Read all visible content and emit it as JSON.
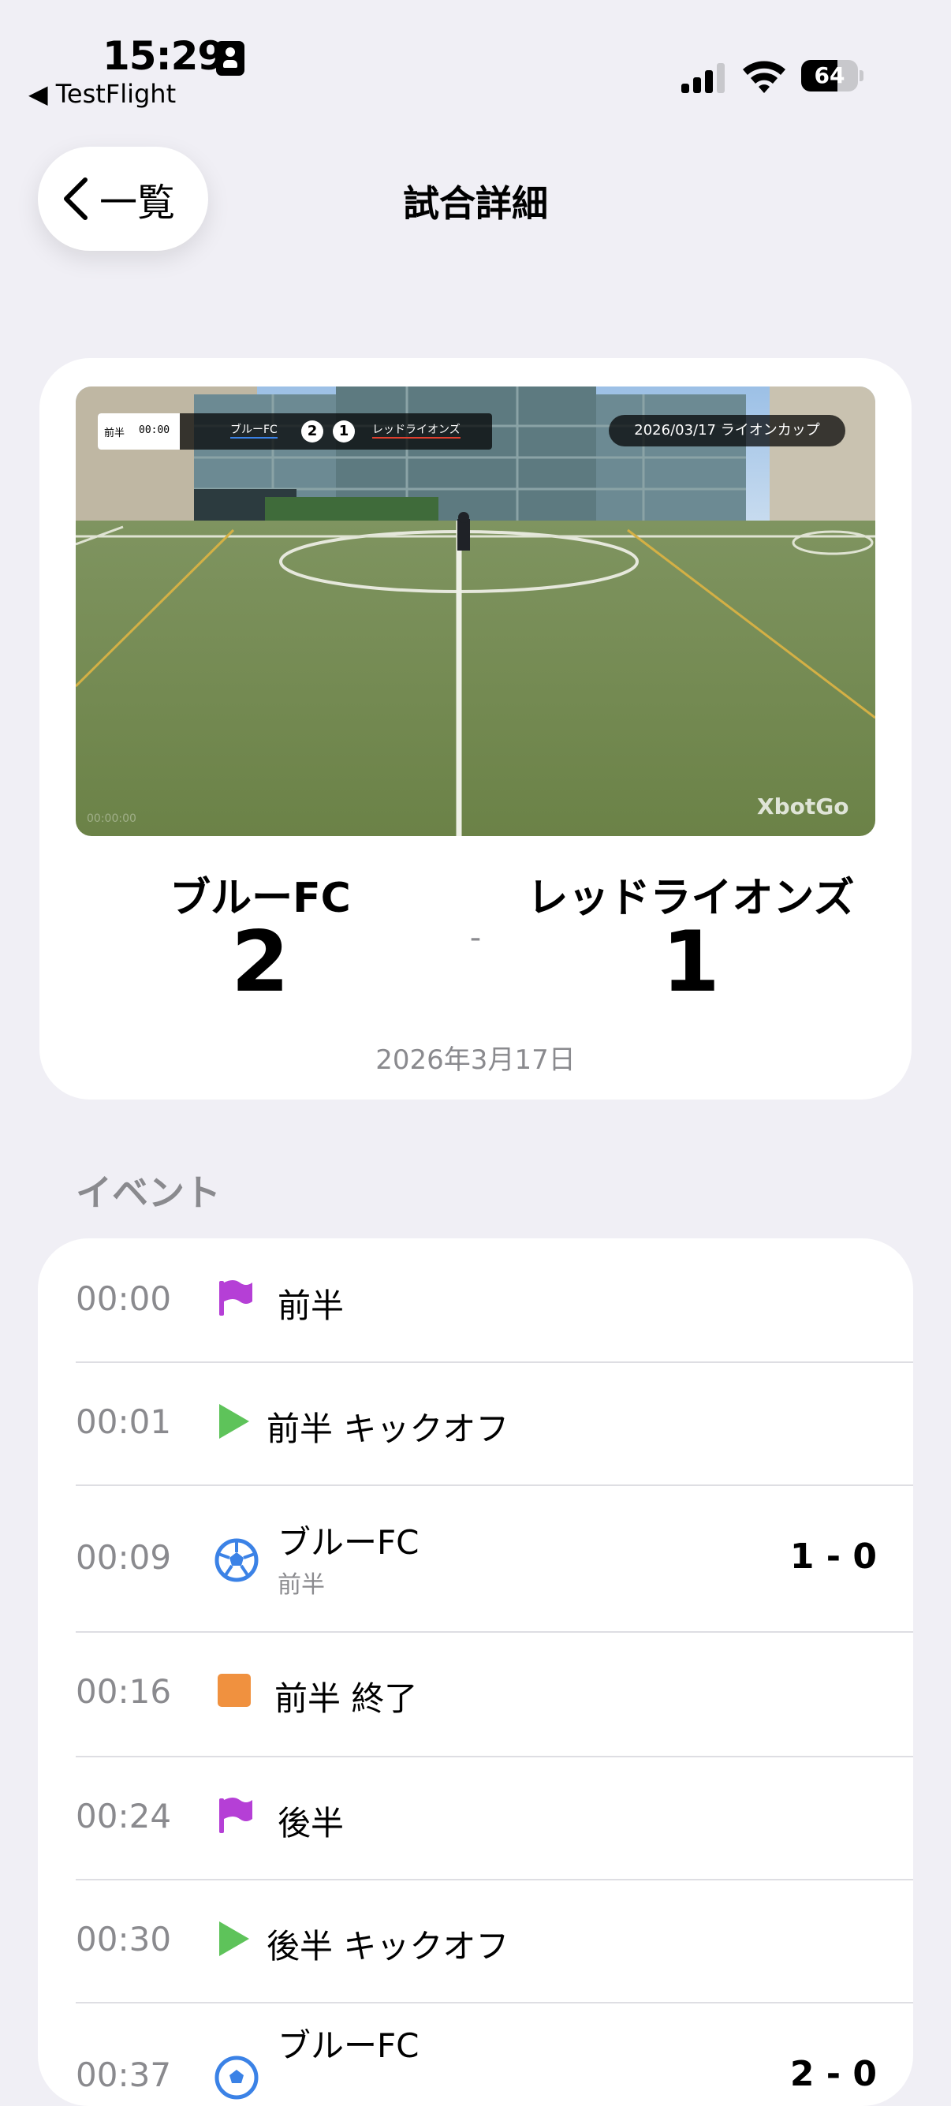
{
  "status_bar": {
    "time": "15:29",
    "back_app": "◀ TestFlight",
    "battery": 64,
    "battery_label": "64"
  },
  "nav": {
    "back_label": "一覧",
    "title": "試合詳細"
  },
  "video_overlay": {
    "period": "前半",
    "clock": "00:00",
    "home_team": "ブルーFC",
    "home_score": "2",
    "away_score": "1",
    "away_team": "レッドライオンズ",
    "caption": "2026/03/17 ライオンカップ",
    "watermark": "XbotGo",
    "timecode": "00:00:00"
  },
  "match": {
    "home_team": "ブルーFC",
    "away_team": "レッドライオンズ",
    "home_score": "2",
    "away_score": "1",
    "separator": "-",
    "date": "2026年3月17日"
  },
  "events_section_title": "イベント",
  "events": [
    {
      "time": "00:00",
      "icon": "flag-icon",
      "label": "前半",
      "sub": "",
      "score": ""
    },
    {
      "time": "00:01",
      "icon": "play-icon",
      "label": "前半 キックオフ",
      "sub": "",
      "score": ""
    },
    {
      "time": "00:09",
      "icon": "soccer-ball-icon",
      "label": "ブルーFC",
      "sub": "前半",
      "score": "1 - 0"
    },
    {
      "time": "00:16",
      "icon": "stop-icon",
      "label": "前半 終了",
      "sub": "",
      "score": ""
    },
    {
      "time": "00:24",
      "icon": "flag-icon",
      "label": "後半",
      "sub": "",
      "score": ""
    },
    {
      "time": "00:30",
      "icon": "play-icon",
      "label": "後半 キックオフ",
      "sub": "",
      "score": ""
    },
    {
      "time": "00:37",
      "icon": "soccer-ball-icon",
      "label": "ブルーFC",
      "sub": "",
      "score": "2 - 0"
    }
  ],
  "colors": {
    "background": "#f0eff5",
    "flag": "#b53fd6",
    "play": "#5ec35a",
    "ball": "#3b82e6",
    "stop": "#f0913f",
    "secondary_text": "#8a8a8e"
  }
}
